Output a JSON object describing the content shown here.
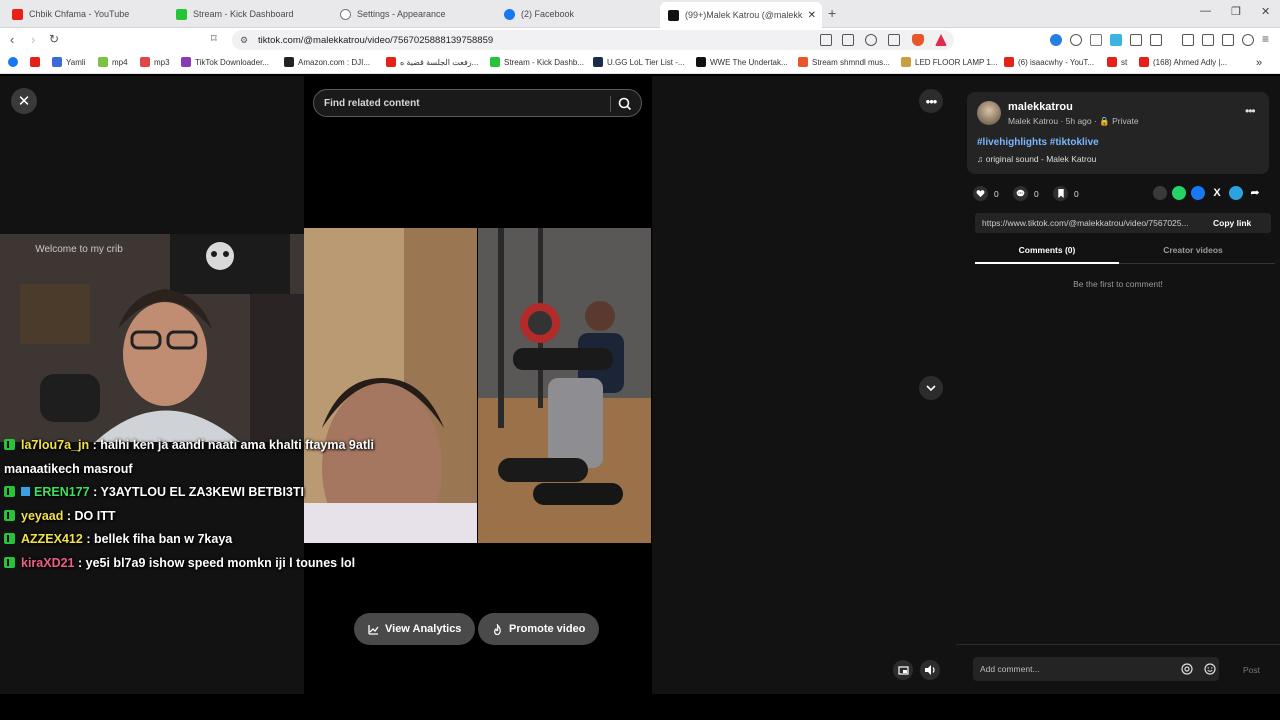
{
  "browser": {
    "tabs": [
      {
        "title": "Chbik Chfama - YouTube",
        "fav_color": "#e62117"
      },
      {
        "title": "Stream - Kick Dashboard",
        "fav_color": "#27c43a"
      },
      {
        "title": "Settings - Appearance",
        "fav_color": "#777777"
      },
      {
        "title": "(2) Facebook",
        "fav_color": "#1877f2"
      },
      {
        "title": "(99+)Malek Katrou (@malekk",
        "fav_color": "#111111"
      }
    ],
    "new_tab_glyph": "+",
    "window_controls": [
      "—",
      "❐",
      "✕"
    ],
    "url": "tiktok.com/@malekkatrou/video/7567025888139758859",
    "bookmarks": [
      {
        "label": "",
        "fav_color": "#1877f2"
      },
      {
        "label": "",
        "fav_color": "#e62117"
      },
      {
        "label": "Yamli",
        "fav_color": "#3b6bd6"
      },
      {
        "label": "mp4",
        "fav_color": "#7dc242"
      },
      {
        "label": "mp3",
        "fav_color": "#e04848"
      },
      {
        "label": "TikTok Downloader...",
        "fav_color": "#8a3ab9"
      },
      {
        "label": "Amazon.com : DJI...",
        "fav_color": "#222222"
      },
      {
        "label": "رفعت الجلسة قضية ه...",
        "fav_color": "#e62117"
      },
      {
        "label": "Stream - Kick Dashb...",
        "fav_color": "#27c43a"
      },
      {
        "label": "U.GG LoL Tier List -...",
        "fav_color": "#1a2b4c"
      },
      {
        "label": "WWE The Undertak...",
        "fav_color": "#111111"
      },
      {
        "label": "Stream shmndl mus...",
        "fav_color": "#e8562a"
      },
      {
        "label": "LED FLOOR LAMP 1...",
        "fav_color": "#c8a040"
      },
      {
        "label": "(6) isaacwhy - YouT...",
        "fav_color": "#e62117"
      },
      {
        "label": "st",
        "fav_color": "#e62117"
      },
      {
        "label": "(168) Ahmed Adly |...",
        "fav_color": "#e62117"
      }
    ],
    "bookmarks_overflow": "»"
  },
  "player": {
    "close_glyph": "✕",
    "search_placeholder": "Find related content",
    "more_glyph": "•••",
    "chat": [
      {
        "user": "la7lou7a_jn",
        "text": ": halhi ken ja aandi naati ama khalti ftayma 9atli manaatikech masrouf"
      },
      {
        "user": "EREN177",
        "text": ": Y3AYTLOU EL ZA3KEWI BETBI3TI"
      },
      {
        "user": "yeyaad",
        "text": ": DO ITT"
      },
      {
        "user": "AZZEX412",
        "text": ": bellek fiha ban w 7kaya"
      },
      {
        "user": "kiraXD21",
        "text": ": ye5i bl7a9 ishow speed momkn iji l tounes lol"
      }
    ],
    "overlay_text": "Welcome to my crib",
    "view_analytics": "View Analytics",
    "promote_video": "Promote video"
  },
  "panel": {
    "username": "malekkatrou",
    "subline": "Malek Katrou · 5h ago · 🔒 Private",
    "hashtags": "#livehighlights #tiktoklive",
    "sound": "♫  original sound - Malek Katrou",
    "likes": "0",
    "comments": "0",
    "saves": "0",
    "link": "https://www.tiktok.com/@malekkatrou/video/7567025...",
    "copy_link": "Copy link",
    "tab_comments": "Comments (0)",
    "tab_creator": "Creator videos",
    "empty_comments": "Be the first to comment!",
    "add_comment": "Add comment...",
    "post": "Post",
    "card_more": "•••"
  },
  "colors": {
    "accent_link": "#7ab7ff",
    "kick_green": "#27c43a",
    "tiktok_bg": "#121212"
  }
}
